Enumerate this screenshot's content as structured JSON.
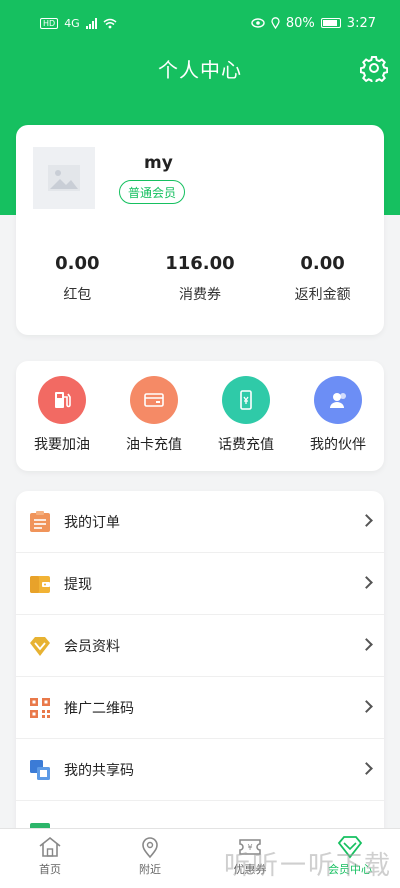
{
  "status_bar": {
    "network": "4G",
    "battery": "80%",
    "time": "3:27"
  },
  "header": {
    "title": "个人中心"
  },
  "profile": {
    "username": "my",
    "member_badge": "普通会员",
    "stats": [
      {
        "value": "0.00",
        "label": "红包"
      },
      {
        "value": "116.00",
        "label": "消费券"
      },
      {
        "value": "0.00",
        "label": "返利金额"
      }
    ]
  },
  "quick_actions": [
    {
      "label": "我要加油",
      "icon": "gas-pump-icon",
      "color": "#f26a63"
    },
    {
      "label": "油卡充值",
      "icon": "card-recharge-icon",
      "color": "#f58a66"
    },
    {
      "label": "话费充值",
      "icon": "phone-recharge-icon",
      "color": "#2fcaa8"
    },
    {
      "label": "我的伙伴",
      "icon": "partners-icon",
      "color": "#6c8ef5"
    }
  ],
  "menu": [
    {
      "label": "我的订单",
      "icon": "orders-icon",
      "color": "#f0945a"
    },
    {
      "label": "提现",
      "icon": "wallet-icon",
      "color": "#f2b335"
    },
    {
      "label": "会员资料",
      "icon": "member-diamond-icon",
      "color": "#e7b232"
    },
    {
      "label": "推广二维码",
      "icon": "qr-code-icon",
      "color": "#e9794a"
    },
    {
      "label": "我的共享码",
      "icon": "share-code-icon",
      "color": "#3b7bd6"
    }
  ],
  "tabbar": [
    {
      "label": "首页",
      "icon": "home-icon"
    },
    {
      "label": "附近",
      "icon": "location-icon"
    },
    {
      "label": "优惠券",
      "icon": "coupon-icon"
    },
    {
      "label": "会员中心",
      "icon": "member-center-icon",
      "active": true
    }
  ],
  "watermark": "听听一听下载",
  "colors": {
    "brand_green": "#16c060"
  }
}
